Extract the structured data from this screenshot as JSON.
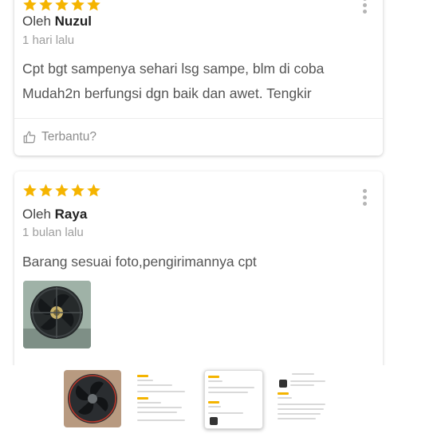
{
  "reviews": [
    {
      "rating": 5,
      "by_prefix": "Oleh",
      "author": "Nuzul",
      "date": "1 hari lalu",
      "text_lines": [
        "Cpt bgt sampenya sehari lsg sampe, blm di coba",
        "Mudah2n berfungsi dgn baik dan awet. Tengkir"
      ],
      "helpful_label": "Terbantu?"
    },
    {
      "rating": 5,
      "by_prefix": "Oleh",
      "author": "Raya",
      "date": "1 bulan lalu",
      "text_lines": [
        "Barang sesuai foto,pengirimannya cpt"
      ]
    }
  ],
  "colors": {
    "star": "#f5b400",
    "muted": "#9e9e9e",
    "card_shadow": "#dddddd"
  },
  "icons": {
    "more": "kebab-menu-icon",
    "helpful": "thumbs-up-icon"
  },
  "thumbnail_strip": {
    "selected_index": 2,
    "count": 4
  }
}
